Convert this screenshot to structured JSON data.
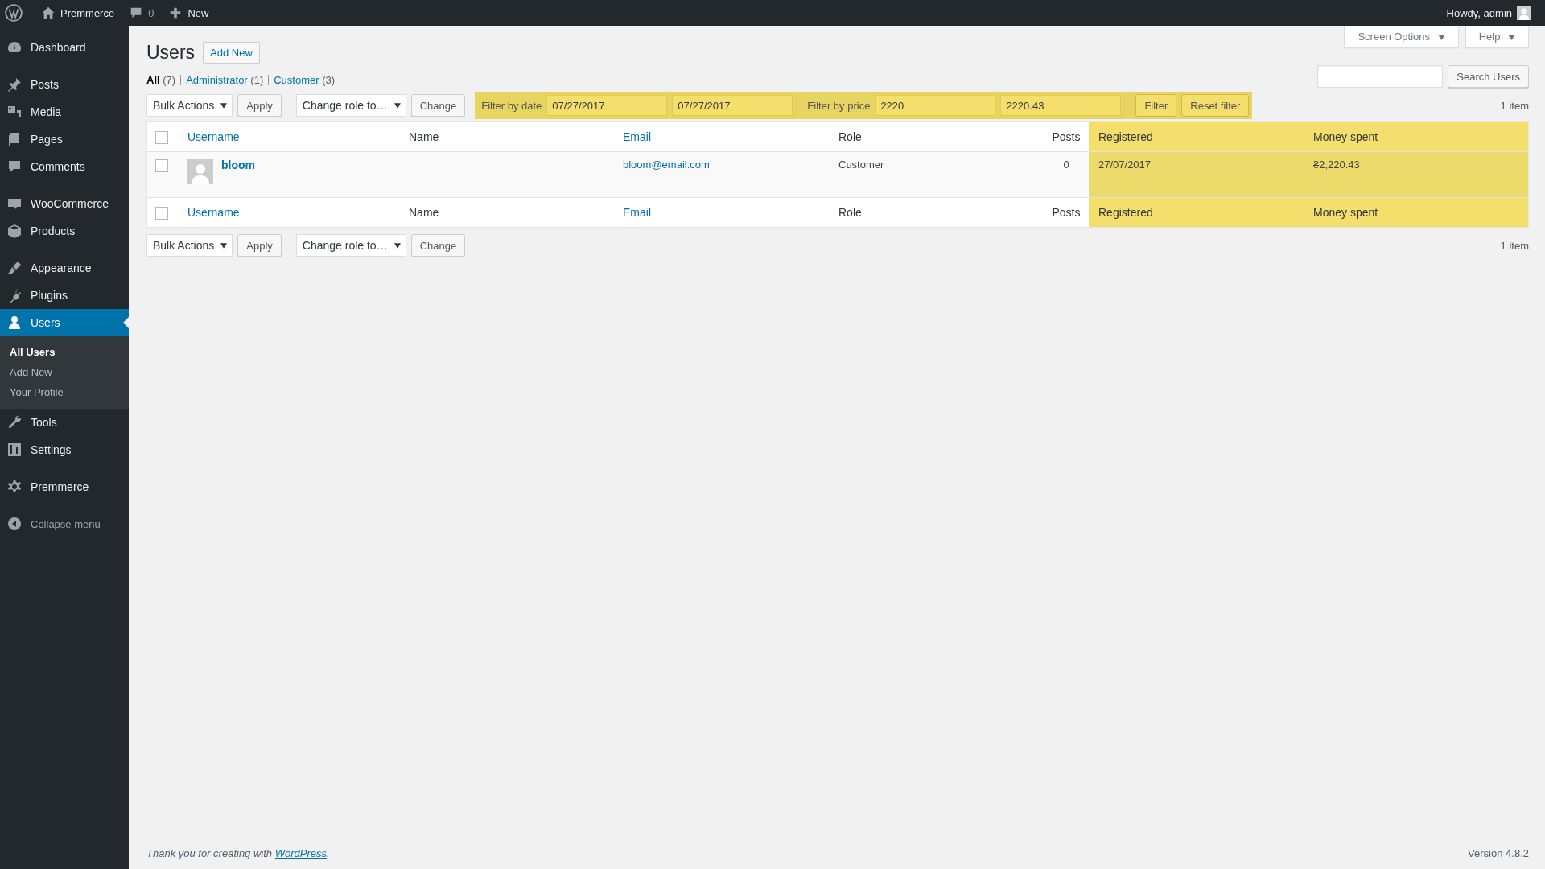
{
  "admin_bar": {
    "site_name": "Premmerce",
    "comments_count": "0",
    "new_label": "New",
    "greeting": "Howdy, admin"
  },
  "sidebar": {
    "groups": [
      [
        {
          "label": "Dashboard",
          "selected": false
        }
      ],
      [
        {
          "label": "Posts",
          "selected": false
        },
        {
          "label": "Media",
          "selected": false
        },
        {
          "label": "Pages",
          "selected": false
        },
        {
          "label": "Comments",
          "selected": false
        }
      ],
      [
        {
          "label": "WooCommerce",
          "selected": false
        },
        {
          "label": "Products",
          "selected": false
        }
      ],
      [
        {
          "label": "Appearance",
          "selected": false
        },
        {
          "label": "Plugins",
          "selected": false
        },
        {
          "label": "Users",
          "selected": true,
          "children": [
            {
              "label": "All Users",
              "selected": true
            },
            {
              "label": "Add New",
              "selected": false
            },
            {
              "label": "Your Profile",
              "selected": false
            }
          ]
        },
        {
          "label": "Tools",
          "selected": false
        },
        {
          "label": "Settings",
          "selected": false
        }
      ],
      [
        {
          "label": "Premmerce",
          "selected": false
        }
      ]
    ],
    "collapse_label": "Collapse menu"
  },
  "header": {
    "title": "Users",
    "add_new": "Add New",
    "screen_options": "Screen Options",
    "help": "Help"
  },
  "views": [
    {
      "label": "All",
      "count": "(7)",
      "selected": true
    },
    {
      "label": "Administrator",
      "count": "(1)",
      "selected": false
    },
    {
      "label": "Customer",
      "count": "(3)",
      "selected": false
    }
  ],
  "search": {
    "button": "Search Users"
  },
  "top_nav": {
    "bulk_actions": "Bulk Actions",
    "apply": "Apply",
    "change_role": "Change role to…",
    "change": "Change",
    "item_count": "1 item"
  },
  "filter": {
    "date_label": "Filter by date",
    "date_from": "07/27/2017",
    "date_to": "07/27/2017",
    "price_label": "Filter by price",
    "price_from": "2220",
    "price_to": "2220.43",
    "filter_button": "Filter",
    "reset_button": "Reset filter"
  },
  "table": {
    "select_all_checked": false,
    "columns": [
      {
        "label": "Username",
        "sortable": true,
        "highlighted": false
      },
      {
        "label": "Name",
        "sortable": false,
        "highlighted": false
      },
      {
        "label": "Email",
        "sortable": true,
        "highlighted": false
      },
      {
        "label": "Role",
        "sortable": false,
        "highlighted": false
      },
      {
        "label": "Posts",
        "sortable": false,
        "highlighted": false
      },
      {
        "label": "Registered",
        "sortable": false,
        "highlighted": true
      },
      {
        "label": "Money spent",
        "sortable": false,
        "highlighted": true
      }
    ],
    "rows": [
      {
        "checked": false,
        "username": "bloom",
        "email": "bloom@email.com",
        "role": "Customer",
        "posts": "0",
        "registered": "27/07/2017",
        "money_spent": "₴2,220.43"
      }
    ],
    "footer_select_all_checked": false,
    "footer_columns": [
      {
        "label": "Username",
        "sortable": true,
        "highlighted": false
      },
      {
        "label": "Name",
        "sortable": false,
        "highlighted": false
      },
      {
        "label": "Email",
        "sortable": true,
        "highlighted": false
      },
      {
        "label": "Role",
        "sortable": false,
        "highlighted": false
      },
      {
        "label": "Posts",
        "sortable": false,
        "highlighted": false
      },
      {
        "label": "Registered",
        "sortable": false,
        "highlighted": true
      },
      {
        "label": "Money spent",
        "sortable": false,
        "highlighted": true
      }
    ]
  },
  "bottom_nav": {
    "bulk_actions": "Bulk Actions",
    "apply": "Apply",
    "change_role": "Change role to…",
    "change": "Change",
    "item_count": "1 item"
  },
  "footer": {
    "text": "Thank you for creating with",
    "link": "WordPress",
    "end": ".",
    "version": "Version 4.8.2"
  }
}
